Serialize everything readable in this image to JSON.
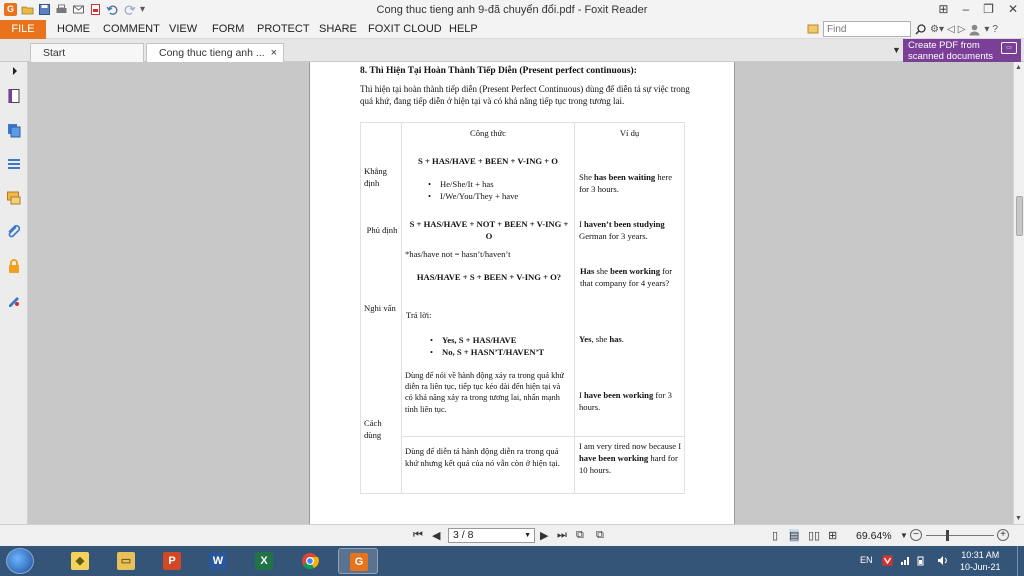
{
  "window": {
    "title": "Cong thuc tieng anh 9-đã chuyển đổi.pdf - Foxit Reader",
    "app_logo_letter": "G"
  },
  "menu": {
    "file": "FILE",
    "items": [
      "HOME",
      "COMMENT",
      "VIEW",
      "FORM",
      "PROTECT",
      "SHARE",
      "FOXIT CLOUD",
      "HELP"
    ],
    "find_placeholder": "Find"
  },
  "tabs": {
    "start": "Start",
    "document": "Cong thuc tieng anh ...",
    "close_glyph": "×"
  },
  "promo": {
    "line1": "Create PDF from",
    "line2": "scanned documents"
  },
  "document": {
    "heading": "8. Thì Hiện Tại Hoàn Thành Tiếp Diễn (Present perfect continuous):",
    "intro": "Thì hiện tại hoàn thành tiếp diễn (Present Perfect Continuous) dùng để diễn tả sự việc trong quá khứ, đang tiếp diễn ở hiện tại và có khả năng tiếp tục trong tương lai.",
    "table": {
      "headers": [
        "Công thức",
        "Ví dụ"
      ],
      "affirmative": {
        "label": "Khẳng định",
        "formula": "S + HAS/HAVE + BEEN + V-ING + O",
        "bullets": [
          "He/She/It + has",
          "I/We/You/They + have"
        ],
        "example_pre": "She ",
        "example_bold": "has been waiting",
        "example_post": " here for 3 hours."
      },
      "negative": {
        "label": "Phủ định",
        "formula": "S + HAS/HAVE + NOT + BEEN + V-ING + O",
        "note": "*has/have not = hasn’t/haven’t",
        "example_pre": "I ",
        "example_bold": "haven’t been studying",
        "example_post": " German for 3 years."
      },
      "question": {
        "label": "Nghi vấn",
        "formula": "HAS/HAVE + S + BEEN + V-ING + O?",
        "answer_label": "Trả lời:",
        "yes_bold": "Yes",
        "yes_rest": ", S + HAS/HAVE",
        "no_bold": "No",
        "no_rest": ", S + HASN’T/HAVEN’T",
        "example_bold1": "Has",
        "example_mid": " she ",
        "example_bold2": "been working",
        "example_post": " for that company for 4 years?",
        "answer_example_bold1": "Yes",
        "answer_example_mid": ", she ",
        "answer_example_bold2": "has",
        "answer_example_post": "."
      },
      "usage": {
        "label": "Cách dùng",
        "use1": "Dùng để nói về hành động xảy ra trong quá khứ diễn ra liên tục, tiếp tục kéo dài đến hiện tại và có khả năng xảy ra trong tương lai, nhấn mạnh tính liên tục.",
        "example1_pre": "I ",
        "example1_bold": "have been working",
        "example1_post": " for 3 hours.",
        "use2": "Dùng để diễn tả hành động diễn ra trong quá khứ nhưng kết quả của nó vẫn còn ở hiện tại.",
        "example2_pre": "I am very tired now because I ",
        "example2_bold": "have been working",
        "example2_post": " hard for 10 hours."
      }
    }
  },
  "status": {
    "page_indicator": "3 / 8",
    "zoom": "69.64%"
  },
  "taskbar": {
    "apps": [
      "start-orb",
      "explorer",
      "file-manager",
      "powerpoint",
      "word",
      "excel",
      "chrome",
      "foxit-reader"
    ],
    "lang": "EN",
    "time": "10:31 AM",
    "date": "10-Jun-21"
  },
  "colors": {
    "accent": "#e8731c",
    "promo": "#7b3f97",
    "taskbar": "#355578"
  }
}
